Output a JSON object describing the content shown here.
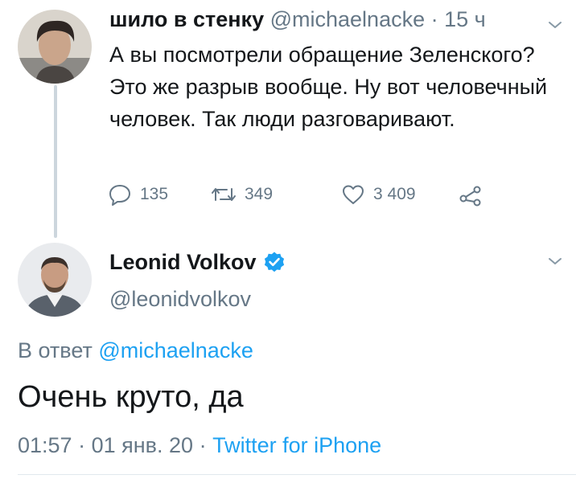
{
  "tweet1": {
    "display_name": "шило в стенку",
    "handle": "@michaelnacke",
    "separator": "·",
    "time": "15 ч",
    "text": "А вы посмотрели обращение Зеленского? Это же разрыв вообще. Ну вот человечный человек. Так люди разговаривают.",
    "actions": {
      "replies": "135",
      "retweets": "349",
      "likes": "3 409"
    }
  },
  "tweet2": {
    "display_name": "Leonid Volkov",
    "handle": "@leonidvolkov",
    "reply_prefix": "В ответ",
    "reply_to": "@michaelnacke",
    "text": "Очень круто, да",
    "time": "01:57",
    "sep1": "·",
    "date": "01 янв. 20",
    "sep2": "·",
    "source": "Twitter for iPhone"
  },
  "colors": {
    "link": "#1da1f2",
    "muted": "#657786",
    "text": "#14171a",
    "thread_line": "#ccd6dd"
  },
  "icons": [
    "reply-icon",
    "retweet-icon",
    "like-icon",
    "share-icon",
    "verified-badge-icon",
    "chevron-down-icon"
  ]
}
